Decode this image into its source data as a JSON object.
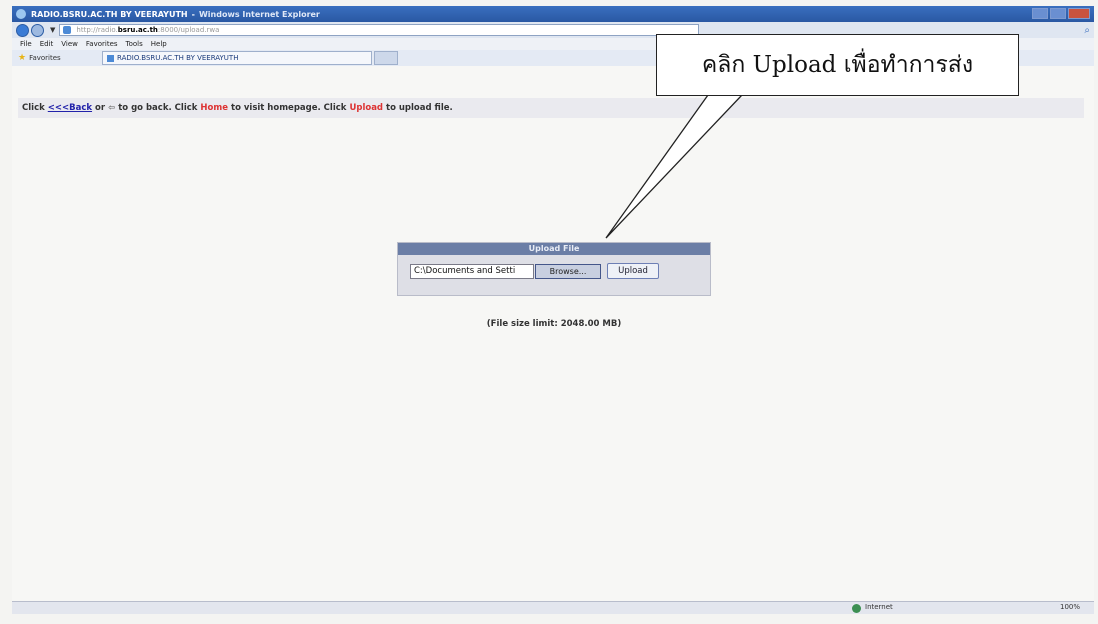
{
  "window": {
    "title": "RADIO.BSRU.AC.TH BY VEERAYUTH",
    "app_name": "Windows Internet Explorer",
    "address_prefix": "http://radio.",
    "address_host": "bsru.ac.th",
    "address_path": ":8000/upload.rwa"
  },
  "menu": [
    "File",
    "Edit",
    "View",
    "Favorites",
    "Tools",
    "Help"
  ],
  "favorites": {
    "label": "Favorites",
    "tab_title": "RADIO.BSRU.AC.TH BY VEERAYUTH"
  },
  "infobar": {
    "t1": "Click",
    "back_link": "<<<Back",
    "t2": "or",
    "back_icon": "⇦",
    "t3": "to go back. Click",
    "home": "Home",
    "t4": "to visit homepage. Click",
    "upload": "Upload",
    "t5": "to upload file."
  },
  "upload_panel": {
    "header": "Upload File",
    "file_value": "C:\\Documents and Setti",
    "browse_label": "Browse...",
    "upload_label": "Upload"
  },
  "size_limit": "(File size limit: 2048.00 MB)",
  "callout": "คลิก Upload เพื่อทำการส่ง",
  "status": {
    "zone": "Internet",
    "zoom": "100%"
  }
}
